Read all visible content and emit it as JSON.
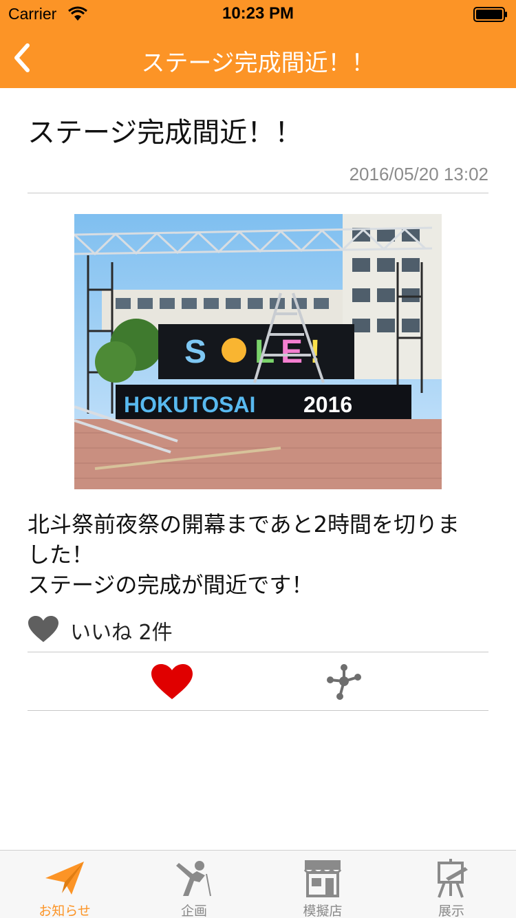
{
  "status_bar": {
    "carrier": "Carrier",
    "time": "10:23 PM"
  },
  "nav": {
    "title": "ステージ完成間近！！",
    "back_icon": "chevron-left-icon"
  },
  "article": {
    "title": "ステージ完成間近！！",
    "date": "2016/05/20 13:02",
    "photo": {
      "sign_text": "SOLE!",
      "banner_text": "HOKUTOSAI 2016"
    },
    "body_lines": [
      "北斗祭前夜祭の開幕まであと2時間を切りま",
      "した！",
      "ステージの完成が間近です！"
    ],
    "likes_text": "いいね 2件"
  },
  "actions": {
    "like_icon": "heart-icon",
    "share_icon": "share-icon",
    "like_color": "#e00000"
  },
  "tabs": [
    {
      "label": "お知らせ",
      "icon": "paper-plane-icon",
      "active": true
    },
    {
      "label": "企画",
      "icon": "performer-icon",
      "active": false
    },
    {
      "label": "模擬店",
      "icon": "storefront-icon",
      "active": false
    },
    {
      "label": "展示",
      "icon": "easel-icon",
      "active": false
    }
  ],
  "colors": {
    "accent": "#fc9426",
    "tab_inactive": "#8a8a8a"
  }
}
